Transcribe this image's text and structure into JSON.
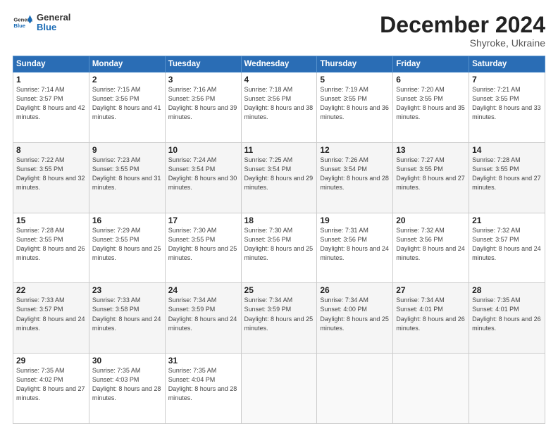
{
  "logo": {
    "general": "General",
    "blue": "Blue"
  },
  "header": {
    "title": "December 2024",
    "subtitle": "Shyroke, Ukraine"
  },
  "days_of_week": [
    "Sunday",
    "Monday",
    "Tuesday",
    "Wednesday",
    "Thursday",
    "Friday",
    "Saturday"
  ],
  "weeks": [
    [
      {
        "day": "1",
        "sunrise": "7:14 AM",
        "sunset": "3:57 PM",
        "daylight": "8 hours and 42 minutes."
      },
      {
        "day": "2",
        "sunrise": "7:15 AM",
        "sunset": "3:56 PM",
        "daylight": "8 hours and 41 minutes."
      },
      {
        "day": "3",
        "sunrise": "7:16 AM",
        "sunset": "3:56 PM",
        "daylight": "8 hours and 39 minutes."
      },
      {
        "day": "4",
        "sunrise": "7:18 AM",
        "sunset": "3:56 PM",
        "daylight": "8 hours and 38 minutes."
      },
      {
        "day": "5",
        "sunrise": "7:19 AM",
        "sunset": "3:55 PM",
        "daylight": "8 hours and 36 minutes."
      },
      {
        "day": "6",
        "sunrise": "7:20 AM",
        "sunset": "3:55 PM",
        "daylight": "8 hours and 35 minutes."
      },
      {
        "day": "7",
        "sunrise": "7:21 AM",
        "sunset": "3:55 PM",
        "daylight": "8 hours and 33 minutes."
      }
    ],
    [
      {
        "day": "8",
        "sunrise": "7:22 AM",
        "sunset": "3:55 PM",
        "daylight": "8 hours and 32 minutes."
      },
      {
        "day": "9",
        "sunrise": "7:23 AM",
        "sunset": "3:55 PM",
        "daylight": "8 hours and 31 minutes."
      },
      {
        "day": "10",
        "sunrise": "7:24 AM",
        "sunset": "3:54 PM",
        "daylight": "8 hours and 30 minutes."
      },
      {
        "day": "11",
        "sunrise": "7:25 AM",
        "sunset": "3:54 PM",
        "daylight": "8 hours and 29 minutes."
      },
      {
        "day": "12",
        "sunrise": "7:26 AM",
        "sunset": "3:54 PM",
        "daylight": "8 hours and 28 minutes."
      },
      {
        "day": "13",
        "sunrise": "7:27 AM",
        "sunset": "3:55 PM",
        "daylight": "8 hours and 27 minutes."
      },
      {
        "day": "14",
        "sunrise": "7:28 AM",
        "sunset": "3:55 PM",
        "daylight": "8 hours and 27 minutes."
      }
    ],
    [
      {
        "day": "15",
        "sunrise": "7:28 AM",
        "sunset": "3:55 PM",
        "daylight": "8 hours and 26 minutes."
      },
      {
        "day": "16",
        "sunrise": "7:29 AM",
        "sunset": "3:55 PM",
        "daylight": "8 hours and 25 minutes."
      },
      {
        "day": "17",
        "sunrise": "7:30 AM",
        "sunset": "3:55 PM",
        "daylight": "8 hours and 25 minutes."
      },
      {
        "day": "18",
        "sunrise": "7:30 AM",
        "sunset": "3:56 PM",
        "daylight": "8 hours and 25 minutes."
      },
      {
        "day": "19",
        "sunrise": "7:31 AM",
        "sunset": "3:56 PM",
        "daylight": "8 hours and 24 minutes."
      },
      {
        "day": "20",
        "sunrise": "7:32 AM",
        "sunset": "3:56 PM",
        "daylight": "8 hours and 24 minutes."
      },
      {
        "day": "21",
        "sunrise": "7:32 AM",
        "sunset": "3:57 PM",
        "daylight": "8 hours and 24 minutes."
      }
    ],
    [
      {
        "day": "22",
        "sunrise": "7:33 AM",
        "sunset": "3:57 PM",
        "daylight": "8 hours and 24 minutes."
      },
      {
        "day": "23",
        "sunrise": "7:33 AM",
        "sunset": "3:58 PM",
        "daylight": "8 hours and 24 minutes."
      },
      {
        "day": "24",
        "sunrise": "7:34 AM",
        "sunset": "3:59 PM",
        "daylight": "8 hours and 24 minutes."
      },
      {
        "day": "25",
        "sunrise": "7:34 AM",
        "sunset": "3:59 PM",
        "daylight": "8 hours and 25 minutes."
      },
      {
        "day": "26",
        "sunrise": "7:34 AM",
        "sunset": "4:00 PM",
        "daylight": "8 hours and 25 minutes."
      },
      {
        "day": "27",
        "sunrise": "7:34 AM",
        "sunset": "4:01 PM",
        "daylight": "8 hours and 26 minutes."
      },
      {
        "day": "28",
        "sunrise": "7:35 AM",
        "sunset": "4:01 PM",
        "daylight": "8 hours and 26 minutes."
      }
    ],
    [
      {
        "day": "29",
        "sunrise": "7:35 AM",
        "sunset": "4:02 PM",
        "daylight": "8 hours and 27 minutes."
      },
      {
        "day": "30",
        "sunrise": "7:35 AM",
        "sunset": "4:03 PM",
        "daylight": "8 hours and 28 minutes."
      },
      {
        "day": "31",
        "sunrise": "7:35 AM",
        "sunset": "4:04 PM",
        "daylight": "8 hours and 28 minutes."
      },
      null,
      null,
      null,
      null
    ]
  ]
}
